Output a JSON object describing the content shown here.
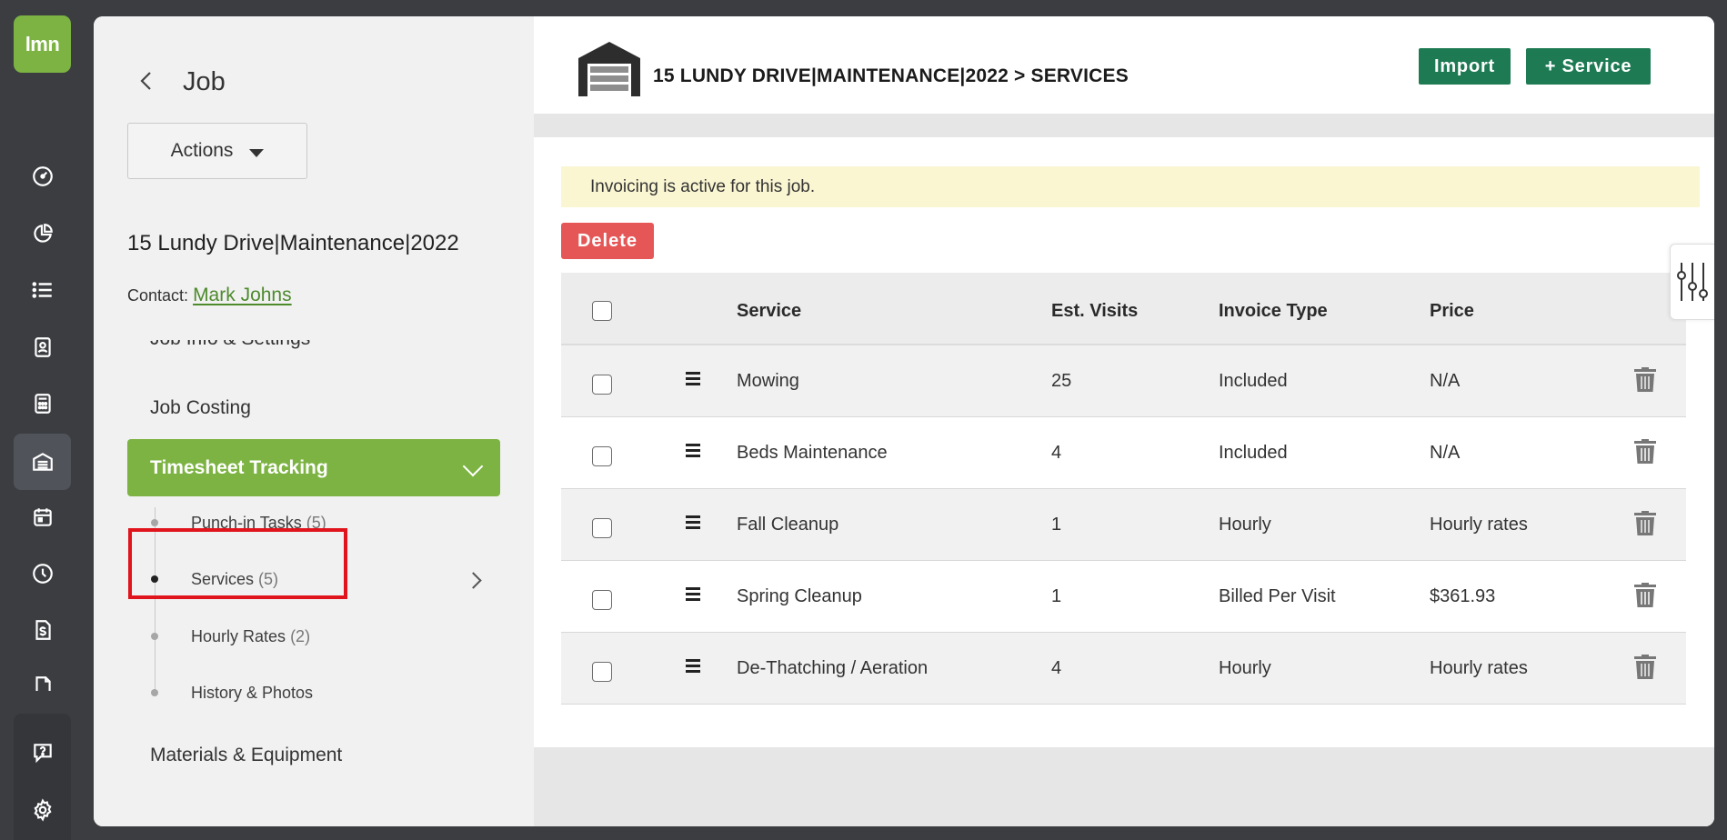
{
  "logo": {
    "text": "lmn"
  },
  "side": {
    "title": "Job",
    "actions_label": "Actions",
    "job_name": "15 Lundy Drive|Maintenance|2022",
    "contact_label": "Contact:",
    "contact_name": "Mark Johns",
    "nav": {
      "job_info": "Job Info & Settings",
      "job_costing": "Job Costing",
      "timesheet_tracking": "Timesheet Tracking",
      "materials": "Materials & Equipment"
    },
    "sub_items": [
      {
        "label": "Punch-in Tasks",
        "count": "(5)"
      },
      {
        "label": "Services",
        "count": "(5)"
      },
      {
        "label": "Hourly Rates",
        "count": "(2)"
      },
      {
        "label": "History & Photos",
        "count": ""
      }
    ]
  },
  "header": {
    "breadcrumb": "15 LUNDY DRIVE|MAINTENANCE|2022 > SERVICES",
    "import_label": "Import",
    "add_service_label": "+ Service"
  },
  "notice": "Invoicing is active for this job.",
  "delete_label": "Delete",
  "table": {
    "columns": [
      "Service",
      "Est. Visits",
      "Invoice Type",
      "Price"
    ],
    "rows": [
      {
        "service": "Mowing",
        "visits": "25",
        "invoice_type": "Included",
        "price": "N/A"
      },
      {
        "service": "Beds Maintenance",
        "visits": "4",
        "invoice_type": "Included",
        "price": "N/A"
      },
      {
        "service": "Fall Cleanup",
        "visits": "1",
        "invoice_type": "Hourly",
        "price": "Hourly rates"
      },
      {
        "service": "Spring Cleanup",
        "visits": "1",
        "invoice_type": "Billed Per Visit",
        "price": "$361.93"
      },
      {
        "service": "De-Thatching / Aeration",
        "visits": "4",
        "invoice_type": "Hourly",
        "price": "Hourly rates"
      }
    ]
  },
  "colors": {
    "brand_green": "#7cb342",
    "action_green": "#1d7a53",
    "delete_red": "#e55757",
    "notice_bg": "#fbf6d2",
    "highlight_red": "#e0141c"
  }
}
